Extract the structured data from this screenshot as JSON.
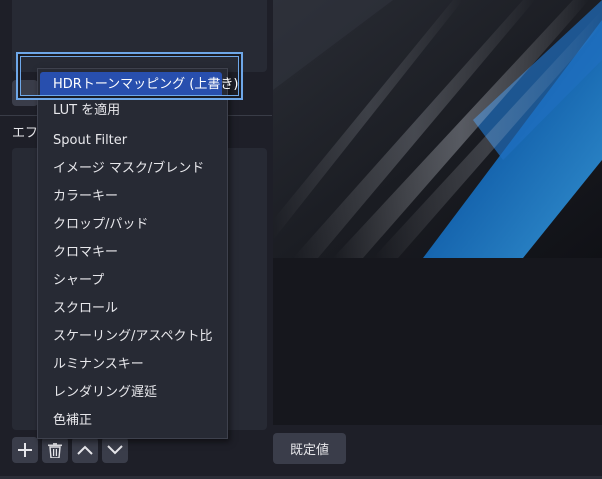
{
  "filters_panel": {
    "label": "エフェ"
  },
  "context_menu": {
    "items": [
      {
        "label": "HDRトーンマッピング (上書き)"
      },
      {
        "label": "LUT を適用"
      },
      {
        "label": "Spout Filter"
      },
      {
        "label": "イメージ マスク/ブレンド"
      },
      {
        "label": "カラーキー"
      },
      {
        "label": "クロップ/パッド"
      },
      {
        "label": "クロマキー"
      },
      {
        "label": "シャープ"
      },
      {
        "label": "スクロール"
      },
      {
        "label": "スケーリング/アスペクト比"
      },
      {
        "label": "ルミナンスキー"
      },
      {
        "label": "レンダリング遅延"
      },
      {
        "label": "色補正"
      }
    ],
    "highlighted_index": 0
  },
  "toolbar": {
    "buttons": [
      {
        "icon": "plus-icon"
      },
      {
        "icon": "trash-icon"
      },
      {
        "icon": "chevron-up-icon"
      },
      {
        "icon": "chevron-down-icon"
      }
    ]
  },
  "preview": {
    "default_button_label": "既定値"
  },
  "colors": {
    "highlight": "#284fae",
    "focus_ring": "#6ea7e8",
    "panel": "#272a34",
    "background": "#1e1f28"
  }
}
